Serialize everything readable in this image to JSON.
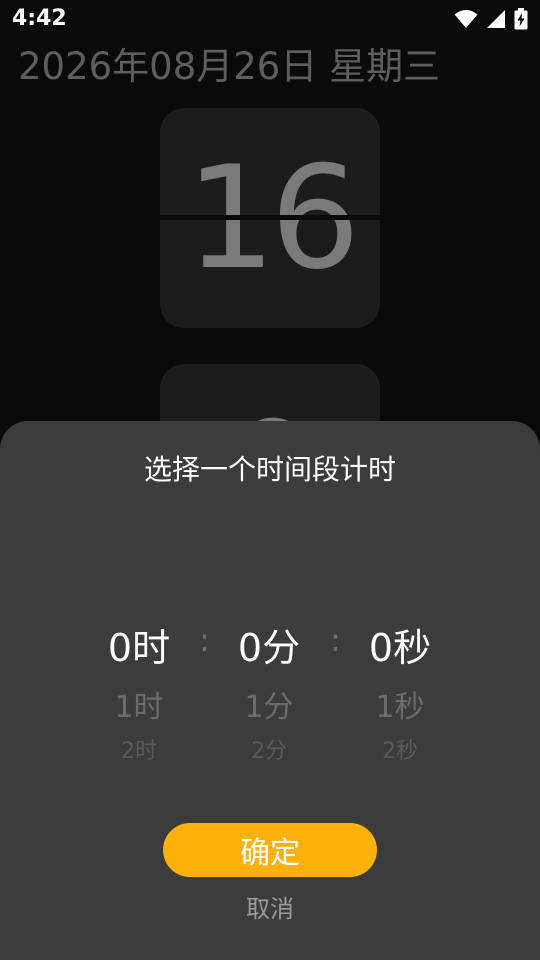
{
  "status_bar": {
    "time": "4:42",
    "icons": [
      "wifi-icon",
      "cellular-signal-icon",
      "battery-charging-icon"
    ]
  },
  "clock": {
    "date_text": "2026年08月26日 星期三",
    "hours": "16",
    "minutes": "0"
  },
  "dialog": {
    "title": "选择一个时间段计时",
    "hours_column": [
      "0时",
      "1时",
      "2时"
    ],
    "minutes_column": [
      "0分",
      "1分",
      "2分"
    ],
    "seconds_column": [
      "0秒",
      "1秒",
      "2秒"
    ],
    "separator": ":",
    "confirm_label": "确定",
    "cancel_label": "取消"
  },
  "colors": {
    "background": "#0a0a0a",
    "sheet": "#3c3c3c",
    "accent": "#fdb20b"
  }
}
